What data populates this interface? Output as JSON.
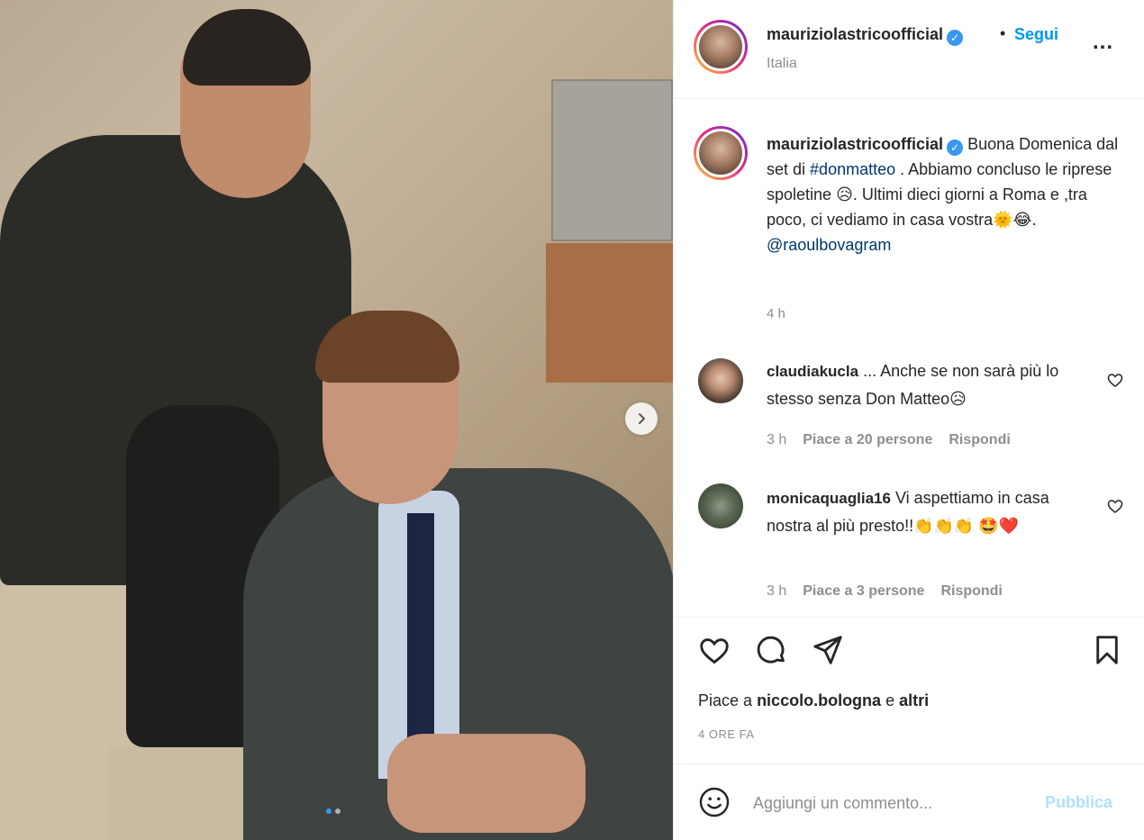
{
  "post": {
    "username": "maurizio­lastricoofficial",
    "follow_label": "Segui",
    "location": "Italia",
    "dot": "•",
    "more_label": "..."
  },
  "caption": {
    "username": "mauriziolastricoofficial",
    "text_1": "Buona Domenica dal set di",
    "hashtag": "#donmatteo",
    "text_2": ". Abbiamo concluso le riprese spoletine",
    "emoji_1": "😥",
    "text_3": ". Ultimi dieci giorni a Roma e ,tra poco, ci vediamo in casa vostra",
    "emoji_2": "🌞😂",
    "text_4": ".",
    "mention": "@raoulbovagram",
    "time": "4 h"
  },
  "comments": [
    {
      "username": "claudiakucla",
      "text": "... Anche se non sarà più lo stesso senza Don Matteo",
      "emoji": "😥",
      "time": "3 h",
      "likes": "Piace a 20 persone",
      "reply": "Rispondi"
    },
    {
      "username": "monicaquaglia16",
      "text": "Vi aspettiamo in casa nostra al più presto!!",
      "emoji": "👏👏👏 🤩❤️",
      "time": "3 h",
      "likes": "Piace a 3 persone",
      "reply": "Rispondi"
    }
  ],
  "likes": {
    "prefix": "Piace a",
    "user": "niccolo.bologna",
    "conj": "e",
    "others": "altri"
  },
  "post_time": "4 ORE FA",
  "add_comment": {
    "placeholder": "Aggiungi un commento...",
    "publish": "Pubblica"
  },
  "icons": {
    "like": "heart-icon",
    "comment": "comment-icon",
    "share": "share-icon",
    "save": "bookmark-icon",
    "emoji": "emoji-icon",
    "next": "chevron-right-icon"
  },
  "colors": {
    "accent": "#0095f6",
    "publish_disabled": "#b2dffc",
    "secondary_text": "#8e8e8e",
    "link": "#00376b"
  }
}
